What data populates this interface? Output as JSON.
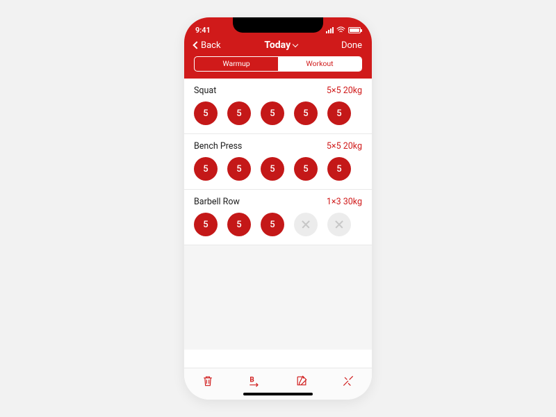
{
  "status": {
    "time": "9:41"
  },
  "nav": {
    "back": "Back",
    "title": "Today",
    "done": "Done"
  },
  "segment": {
    "warmup": "Warmup",
    "workout": "Workout",
    "active": "workout"
  },
  "exercises": [
    {
      "name": "Squat",
      "meta": "5×5 20kg",
      "sets": [
        {
          "v": "5",
          "done": true
        },
        {
          "v": "5",
          "done": true
        },
        {
          "v": "5",
          "done": true
        },
        {
          "v": "5",
          "done": true
        },
        {
          "v": "5",
          "done": true
        }
      ]
    },
    {
      "name": "Bench Press",
      "meta": "5×5 20kg",
      "sets": [
        {
          "v": "5",
          "done": true
        },
        {
          "v": "5",
          "done": true
        },
        {
          "v": "5",
          "done": true
        },
        {
          "v": "5",
          "done": true
        },
        {
          "v": "5",
          "done": true
        }
      ]
    },
    {
      "name": "Barbell Row",
      "meta": "1×3 30kg",
      "sets": [
        {
          "v": "5",
          "done": true
        },
        {
          "v": "5",
          "done": true
        },
        {
          "v": "5",
          "done": true
        },
        {
          "skip": true
        },
        {
          "skip": true
        }
      ]
    }
  ],
  "toolbar": [
    "trash",
    "swap",
    "edit",
    "tools"
  ],
  "colors": {
    "accent": "#d01a1a"
  }
}
